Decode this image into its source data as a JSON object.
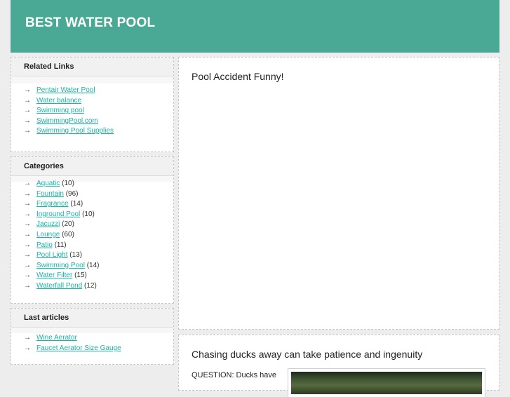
{
  "site": {
    "title": "BEST WATER POOL"
  },
  "sidebar": {
    "related": {
      "heading": "Related Links",
      "links": [
        "Pentair Water Pool",
        "Water balance",
        "Swimming pool",
        "SwimmingPool.com",
        "Swimming Pool Supplies"
      ]
    },
    "categories": {
      "heading": "Categories",
      "items": [
        {
          "name": "Aquatic",
          "count": "(10)"
        },
        {
          "name": "Fountain",
          "count": "(96)"
        },
        {
          "name": "Fragrance",
          "count": "(14)"
        },
        {
          "name": "Inground Pool",
          "count": "(10)"
        },
        {
          "name": "Jacuzzi",
          "count": "(20)"
        },
        {
          "name": "Lounge",
          "count": "(60)"
        },
        {
          "name": "Patio",
          "count": "(11)"
        },
        {
          "name": "Pool Light",
          "count": "(13)"
        },
        {
          "name": "Swimming Pool",
          "count": "(14)"
        },
        {
          "name": "Water Filter",
          "count": "(15)"
        },
        {
          "name": "Waterfall Pond",
          "count": "(12)"
        }
      ]
    },
    "last_articles": {
      "heading": "Last articles",
      "links": [
        "Wine Aerator",
        "Faucet Aerator Size Gauge"
      ]
    }
  },
  "main": {
    "posts": [
      {
        "title": "Pool Accident Funny!"
      },
      {
        "title": "Chasing ducks away can take patience and ingenuity",
        "excerpt": "QUESTION: Ducks have"
      }
    ]
  },
  "colors": {
    "header": "#4aa995",
    "link": "#18b4a8",
    "page_bg": "#ededed"
  }
}
